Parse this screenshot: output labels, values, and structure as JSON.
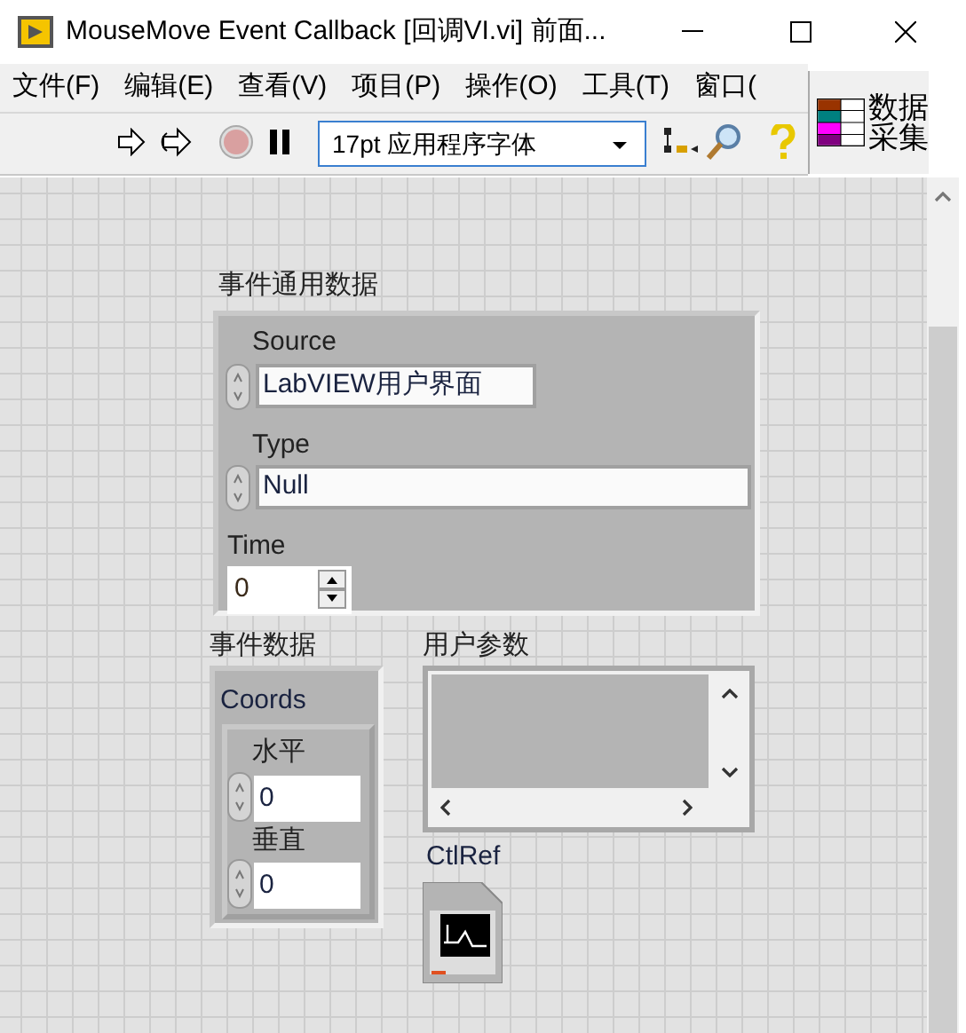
{
  "window": {
    "title": "MouseMove Event Callback [回调VI.vi] 前面..."
  },
  "menu": [
    "文件(F)",
    "编辑(E)",
    "查看(V)",
    "项目(P)",
    "操作(O)",
    "工具(T)",
    "窗口("
  ],
  "toolbar": {
    "font": "17pt 应用程序字体"
  },
  "vi_icon": {
    "lines": [
      "数据",
      "采集"
    ]
  },
  "common_cluster": {
    "label": "事件通用数据",
    "source": {
      "label": "Source",
      "value": "LabVIEW用户界面"
    },
    "type": {
      "label": "Type",
      "value": "Null"
    },
    "time": {
      "label": "Time",
      "value": "0"
    }
  },
  "event_cluster": {
    "label": "事件数据",
    "coords": {
      "label": "Coords",
      "horizontal": {
        "label": "水平",
        "value": "0"
      },
      "vertical": {
        "label": "垂直",
        "value": "0"
      }
    }
  },
  "user_param": {
    "label": "用户参数"
  },
  "ctlref": {
    "label": "CtlRef"
  }
}
